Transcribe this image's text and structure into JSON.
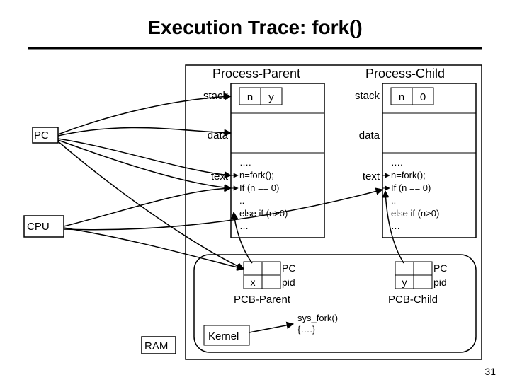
{
  "title": "Execution Trace: fork()",
  "pc_label": "PC",
  "cpu_label": "CPU",
  "ram_label": "RAM",
  "kernel_label": "Kernel",
  "syscall_code": "sys_fork()\n{….}",
  "parent": {
    "header": "Process-Parent",
    "stack_label": "stack",
    "data_label": "data",
    "text_label": "text",
    "n_label": "n",
    "n_value": "y",
    "code_dots": "….",
    "code_line1": "n=fork();",
    "code_line2": "If (n == 0)",
    "code_line3": "..",
    "code_line4": "else if (n>0)",
    "code_line5": "…",
    "pcb_label": "PCB-Parent",
    "pc_reg": "PC",
    "pid_reg": "pid",
    "pid_value": "x"
  },
  "child": {
    "header": "Process-Child",
    "stack_label": "stack",
    "data_label": "data",
    "text_label": "text",
    "n_label": "n",
    "n_value": "0",
    "code_dots": "….",
    "code_line1": "n=fork();",
    "code_line2": "If (n == 0)",
    "code_line3": "..",
    "code_line4": "else if (n>0)",
    "code_line5": "…",
    "pcb_label": "PCB-Child",
    "pc_reg": "PC",
    "pid_reg": "pid",
    "pid_value": "y"
  },
  "page_number": "31"
}
